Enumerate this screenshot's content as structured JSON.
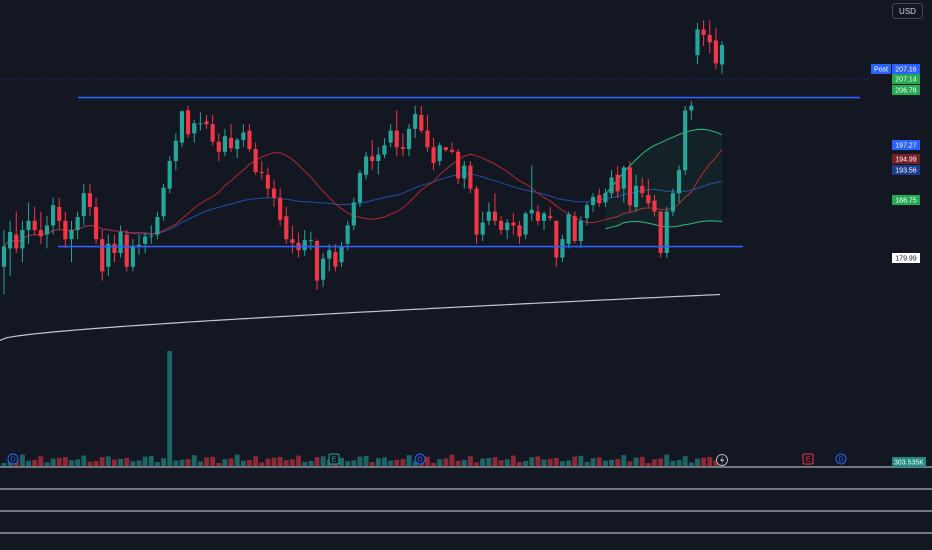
{
  "toolbar": {
    "currency": "USD"
  },
  "price_axis": {
    "labels": [
      {
        "text": "Post",
        "kind": "post"
      },
      {
        "text": "207.16",
        "kind": "post"
      },
      {
        "text": "207.14",
        "kind": "last"
      },
      {
        "text": "206.78",
        "kind": "green"
      },
      {
        "text": "197.27",
        "kind": "blue"
      },
      {
        "text": "194.99",
        "kind": "red"
      },
      {
        "text": "193.56",
        "kind": "navy"
      },
      {
        "text": "188.75",
        "kind": "green"
      },
      {
        "text": "179.99",
        "kind": "white"
      }
    ],
    "volume_label": "303.535K"
  },
  "markers": [
    {
      "text": "D",
      "kind": "dividend"
    },
    {
      "text": "E",
      "kind": "earnings"
    },
    {
      "text": "D",
      "kind": "dividend"
    },
    {
      "text": "E",
      "kind": "earnings_upcoming"
    },
    {
      "text": "D",
      "kind": "dividend_upcoming"
    }
  ],
  "colors": {
    "background": "#131722",
    "up": "#26a69a",
    "down": "#f23645",
    "level_line": "#2962ff",
    "sma200": "#e6e6e6",
    "ma_red": "#b22833",
    "ma_blue": "#1e4fa8",
    "band": "#2bbf7a",
    "label_blue": "#2962ff",
    "label_green": "#22ab50"
  },
  "chart_data": {
    "type": "candlestick",
    "y_range": [
      162,
      212
    ],
    "candles": [
      {
        "o": 183,
        "h": 187,
        "l": 180,
        "c": 185.2
      },
      {
        "o": 185,
        "h": 188,
        "l": 182,
        "c": 186.8
      },
      {
        "o": 186.5,
        "h": 189,
        "l": 184.5,
        "c": 185
      },
      {
        "o": 185,
        "h": 188,
        "l": 183.5,
        "c": 187
      },
      {
        "o": 187,
        "h": 190,
        "l": 185.5,
        "c": 188
      },
      {
        "o": 188,
        "h": 189.5,
        "l": 186.5,
        "c": 187
      },
      {
        "o": 187,
        "h": 189,
        "l": 185.5,
        "c": 186.3
      },
      {
        "o": 186.5,
        "h": 188.5,
        "l": 185,
        "c": 187.5
      },
      {
        "o": 187.5,
        "h": 190.5,
        "l": 186.5,
        "c": 189.7
      },
      {
        "o": 189.5,
        "h": 190.5,
        "l": 187,
        "c": 188
      },
      {
        "o": 188,
        "h": 189,
        "l": 185,
        "c": 186
      },
      {
        "o": 186,
        "h": 188,
        "l": 183.5,
        "c": 187
      },
      {
        "o": 187,
        "h": 189,
        "l": 186,
        "c": 188.4
      },
      {
        "o": 188.5,
        "h": 192,
        "l": 187.5,
        "c": 191
      },
      {
        "o": 191,
        "h": 192,
        "l": 188.5,
        "c": 189.5
      },
      {
        "o": 189.5,
        "h": 190.5,
        "l": 185.5,
        "c": 186
      },
      {
        "o": 186,
        "h": 187,
        "l": 181.5,
        "c": 182.5
      },
      {
        "o": 183,
        "h": 186.5,
        "l": 182,
        "c": 185.5
      },
      {
        "o": 185.5,
        "h": 186.5,
        "l": 183.5,
        "c": 184.5
      },
      {
        "o": 184.5,
        "h": 187.5,
        "l": 184,
        "c": 186.8
      },
      {
        "o": 186.5,
        "h": 187,
        "l": 182.5,
        "c": 183
      },
      {
        "o": 183,
        "h": 186,
        "l": 182.5,
        "c": 185.2
      },
      {
        "o": 185.2,
        "h": 186.5,
        "l": 184.3,
        "c": 185.4
      },
      {
        "o": 185.5,
        "h": 186.7,
        "l": 184.5,
        "c": 186.3
      },
      {
        "o": 186.3,
        "h": 187.5,
        "l": 185.5,
        "c": 186.4
      },
      {
        "o": 186.5,
        "h": 189,
        "l": 186,
        "c": 188.4
      },
      {
        "o": 188.5,
        "h": 192,
        "l": 188,
        "c": 191.6
      },
      {
        "o": 191.5,
        "h": 195,
        "l": 191,
        "c": 194.5
      },
      {
        "o": 194.5,
        "h": 197.5,
        "l": 193.5,
        "c": 196.7
      },
      {
        "o": 196.5,
        "h": 200,
        "l": 196,
        "c": 199.9
      },
      {
        "o": 200,
        "h": 200.5,
        "l": 197,
        "c": 197.4
      },
      {
        "o": 197.5,
        "h": 199,
        "l": 196.5,
        "c": 198.6
      },
      {
        "o": 198.6,
        "h": 199.8,
        "l": 197.8,
        "c": 198.6
      },
      {
        "o": 198.8,
        "h": 199.5,
        "l": 198,
        "c": 198.5
      },
      {
        "o": 198.5,
        "h": 199.5,
        "l": 196.2,
        "c": 196.6
      },
      {
        "o": 196.6,
        "h": 197.5,
        "l": 194.5,
        "c": 195.5
      },
      {
        "o": 195.5,
        "h": 198,
        "l": 195,
        "c": 197.2
      },
      {
        "o": 197,
        "h": 198.5,
        "l": 195.5,
        "c": 195.9
      },
      {
        "o": 195.8,
        "h": 197,
        "l": 194.8,
        "c": 196.8
      },
      {
        "o": 196.8,
        "h": 198.5,
        "l": 196,
        "c": 197.6
      },
      {
        "o": 197.8,
        "h": 198.5,
        "l": 195.5,
        "c": 195.8
      },
      {
        "o": 195.8,
        "h": 196.5,
        "l": 193,
        "c": 193.3
      },
      {
        "o": 193.3,
        "h": 194.5,
        "l": 192.5,
        "c": 193.2
      },
      {
        "o": 193,
        "h": 193.8,
        "l": 190.5,
        "c": 191.5
      },
      {
        "o": 191.5,
        "h": 192.5,
        "l": 189.5,
        "c": 190.5
      },
      {
        "o": 190.5,
        "h": 191.5,
        "l": 187.5,
        "c": 188.1
      },
      {
        "o": 188.5,
        "h": 189.5,
        "l": 185.5,
        "c": 186
      },
      {
        "o": 186,
        "h": 187.5,
        "l": 184.5,
        "c": 185.6
      },
      {
        "o": 185.6,
        "h": 186.7,
        "l": 184,
        "c": 184.8
      },
      {
        "o": 184.8,
        "h": 187,
        "l": 184.2,
        "c": 185.9
      },
      {
        "o": 185.8,
        "h": 186.8,
        "l": 184.8,
        "c": 185.9
      },
      {
        "o": 185.8,
        "h": 186,
        "l": 180.5,
        "c": 181.5
      },
      {
        "o": 181.6,
        "h": 184.5,
        "l": 180.8,
        "c": 183.9
      },
      {
        "o": 183.9,
        "h": 185.5,
        "l": 182.5,
        "c": 184.8
      },
      {
        "o": 184.6,
        "h": 185.5,
        "l": 182.5,
        "c": 183
      },
      {
        "o": 183.5,
        "h": 185.7,
        "l": 183,
        "c": 185.2
      },
      {
        "o": 185.5,
        "h": 188,
        "l": 184.8,
        "c": 187.5
      },
      {
        "o": 187.5,
        "h": 190.5,
        "l": 187,
        "c": 190
      },
      {
        "o": 190,
        "h": 193.5,
        "l": 189.5,
        "c": 193.2
      },
      {
        "o": 193,
        "h": 195.5,
        "l": 192.5,
        "c": 195
      },
      {
        "o": 195,
        "h": 196.8,
        "l": 193.5,
        "c": 194.5
      },
      {
        "o": 194.5,
        "h": 196,
        "l": 193,
        "c": 195.2
      },
      {
        "o": 195.2,
        "h": 197,
        "l": 194.8,
        "c": 196.2
      },
      {
        "o": 196.5,
        "h": 198.5,
        "l": 196,
        "c": 197.8
      },
      {
        "o": 197.8,
        "h": 200,
        "l": 195,
        "c": 196
      },
      {
        "o": 196,
        "h": 197.5,
        "l": 195,
        "c": 195.8
      },
      {
        "o": 195.8,
        "h": 198.5,
        "l": 195,
        "c": 198
      },
      {
        "o": 198,
        "h": 200.5,
        "l": 197,
        "c": 199.6
      },
      {
        "o": 199.5,
        "h": 200.5,
        "l": 197.5,
        "c": 197.8
      },
      {
        "o": 197.8,
        "h": 199.5,
        "l": 195.5,
        "c": 196
      },
      {
        "o": 196,
        "h": 197,
        "l": 193.5,
        "c": 194.3
      },
      {
        "o": 194.5,
        "h": 196.5,
        "l": 194,
        "c": 196.2
      },
      {
        "o": 196,
        "h": 196,
        "l": 195.5,
        "c": 195.7
      },
      {
        "o": 195.7,
        "h": 196.5,
        "l": 195.3,
        "c": 195.5
      },
      {
        "o": 195.5,
        "h": 195.8,
        "l": 192,
        "c": 192.6
      },
      {
        "o": 192.6,
        "h": 194.5,
        "l": 191.5,
        "c": 194
      },
      {
        "o": 194,
        "h": 194.5,
        "l": 191,
        "c": 191.5
      },
      {
        "o": 191.5,
        "h": 191.8,
        "l": 185.5,
        "c": 186.5
      },
      {
        "o": 186.5,
        "h": 189,
        "l": 185.8,
        "c": 187.8
      },
      {
        "o": 188,
        "h": 190,
        "l": 187.5,
        "c": 189
      },
      {
        "o": 189,
        "h": 191,
        "l": 187.5,
        "c": 188
      },
      {
        "o": 188,
        "h": 188.5,
        "l": 186.5,
        "c": 187
      },
      {
        "o": 187,
        "h": 188.2,
        "l": 186,
        "c": 187.8
      },
      {
        "o": 187.8,
        "h": 188.8,
        "l": 186.5,
        "c": 187.5
      },
      {
        "o": 187.5,
        "h": 188,
        "l": 185.5,
        "c": 186.3
      },
      {
        "o": 186.5,
        "h": 189,
        "l": 186,
        "c": 188.8
      },
      {
        "o": 188.8,
        "h": 194,
        "l": 188,
        "c": 189.2
      },
      {
        "o": 189,
        "h": 189.7,
        "l": 187.5,
        "c": 188
      },
      {
        "o": 188,
        "h": 189,
        "l": 187,
        "c": 188.8
      },
      {
        "o": 188.5,
        "h": 189.5,
        "l": 188,
        "c": 188.3
      },
      {
        "o": 188,
        "h": 188,
        "l": 183,
        "c": 184
      },
      {
        "o": 184,
        "h": 186.5,
        "l": 183.5,
        "c": 186
      },
      {
        "o": 185.5,
        "h": 189,
        "l": 185,
        "c": 188.7
      },
      {
        "o": 188.5,
        "h": 189,
        "l": 185.5,
        "c": 185.8
      },
      {
        "o": 185.8,
        "h": 188.5,
        "l": 185,
        "c": 188
      },
      {
        "o": 188.3,
        "h": 190,
        "l": 187.5,
        "c": 189.7
      },
      {
        "o": 189.7,
        "h": 191,
        "l": 189,
        "c": 190.6
      },
      {
        "o": 190.8,
        "h": 191.5,
        "l": 189.5,
        "c": 189.9
      },
      {
        "o": 190,
        "h": 191.5,
        "l": 189.5,
        "c": 191
      },
      {
        "o": 191,
        "h": 193.5,
        "l": 190.5,
        "c": 192.7
      },
      {
        "o": 193,
        "h": 194,
        "l": 190.5,
        "c": 191.2
      },
      {
        "o": 191.5,
        "h": 194,
        "l": 190,
        "c": 193.8
      },
      {
        "o": 193.8,
        "h": 194.5,
        "l": 189,
        "c": 189.7
      },
      {
        "o": 189.5,
        "h": 193,
        "l": 189,
        "c": 191.8
      },
      {
        "o": 191.8,
        "h": 192.7,
        "l": 190.5,
        "c": 191
      },
      {
        "o": 190.8,
        "h": 192.5,
        "l": 189.5,
        "c": 189.9
      },
      {
        "o": 190.2,
        "h": 190.8,
        "l": 188.5,
        "c": 189
      },
      {
        "o": 189,
        "h": 189,
        "l": 184,
        "c": 184.5
      },
      {
        "o": 184.5,
        "h": 189.5,
        "l": 184,
        "c": 189
      },
      {
        "o": 189,
        "h": 191.5,
        "l": 188.5,
        "c": 191
      },
      {
        "o": 191,
        "h": 194,
        "l": 190,
        "c": 193.5
      },
      {
        "o": 193.5,
        "h": 200.5,
        "l": 193,
        "c": 200
      },
      {
        "o": 200,
        "h": 201,
        "l": 199,
        "c": 200.5
      },
      {
        "o": 206,
        "h": 209.5,
        "l": 205,
        "c": 208.8
      },
      {
        "o": 208.8,
        "h": 209.8,
        "l": 207,
        "c": 208.2
      },
      {
        "o": 208.2,
        "h": 209.8,
        "l": 206.2,
        "c": 207.4
      },
      {
        "o": 207.6,
        "h": 209,
        "l": 204.5,
        "c": 205.1
      },
      {
        "o": 205,
        "h": 207.5,
        "l": 204,
        "c": 207.1
      }
    ],
    "indicators": {
      "sma200": {
        "start": 175.0,
        "end": 180.0
      },
      "bollinger": {
        "upper": 197.27,
        "lower": 188.75
      },
      "ma_red_last": 194.99,
      "ma_blue_last": 193.56
    },
    "levels": [
      {
        "name": "resistance",
        "value": 201.4
      },
      {
        "name": "support",
        "value": 185.2
      }
    ],
    "volume": {
      "last": "303.535K",
      "peak_index": 27
    }
  }
}
